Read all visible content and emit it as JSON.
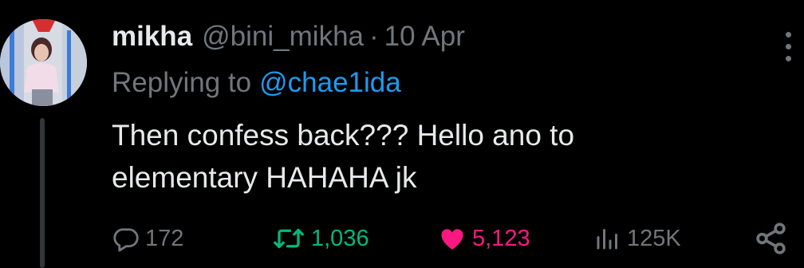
{
  "tweet": {
    "author_name": "mikha",
    "author_handle": "@bini_mikha",
    "separator": "·",
    "timestamp": "10 Apr",
    "replying_to_prefix": "Replying to",
    "replying_to_handle": "@chae1ida",
    "text_lines": [
      "Then confess back??? Hello ano to",
      "elementary HAHAHA jk"
    ]
  },
  "metrics": {
    "replies": "172",
    "reposts": "1,036",
    "likes": "5,123",
    "views": "125K"
  },
  "icons": {
    "reply": "speech-bubble-icon",
    "repost": "repost-arrows-icon",
    "like": "heart-icon-filled",
    "views": "bar-chart-icon",
    "share": "share-nodes-icon",
    "more": "vertical-ellipsis-icon"
  },
  "colors": {
    "background": "#000000",
    "primary_text": "#e7e9ea",
    "secondary_text": "#71767b",
    "mention": "#1d9bf0",
    "repost_active": "#00ba7c",
    "like_active": "#f91880"
  }
}
